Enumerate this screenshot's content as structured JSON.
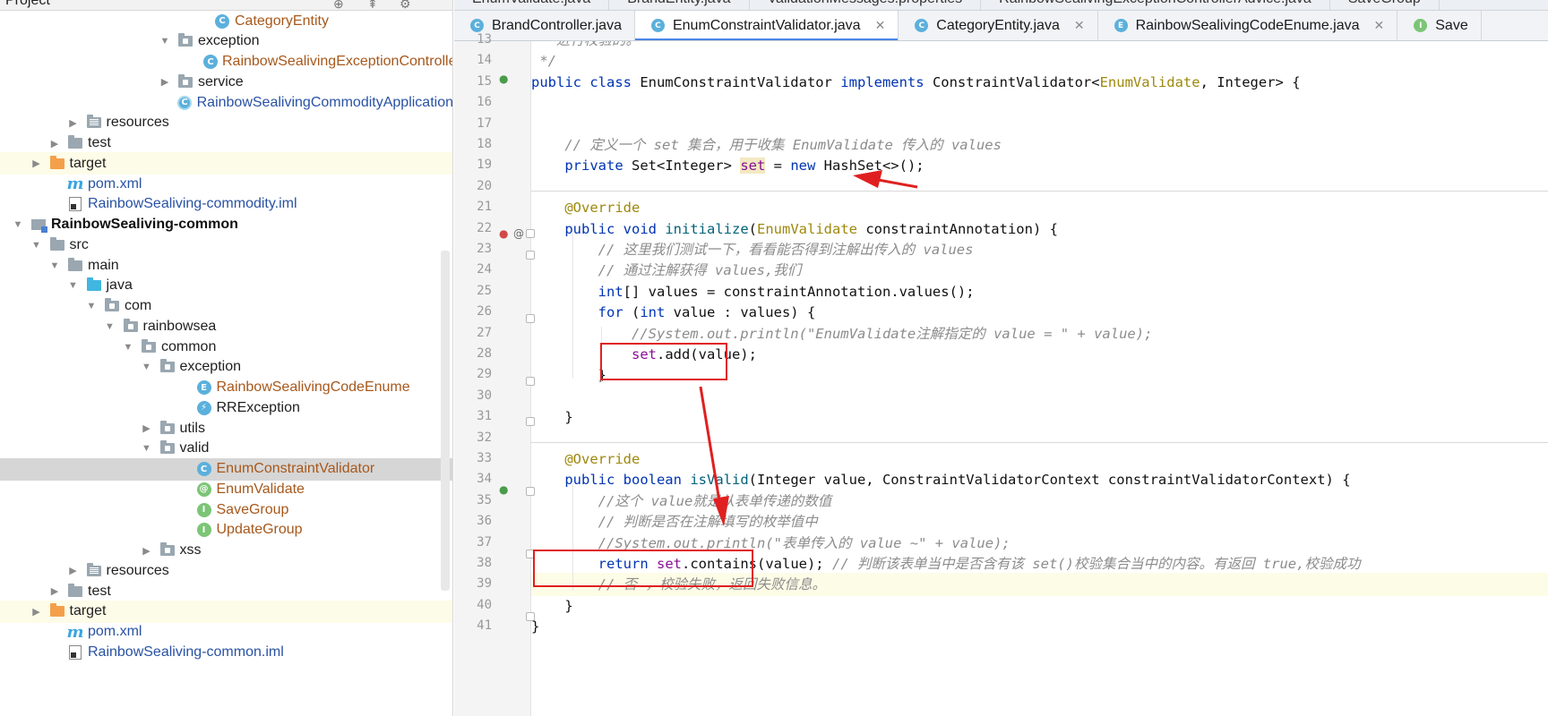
{
  "tree": {
    "header_title": "Project",
    "rows": [
      {
        "label": "CategoryEntity",
        "indent": 10,
        "kind": "class",
        "color": "brown"
      },
      {
        "label": "exception",
        "indent": 8,
        "kind": "pkg",
        "arrow": "down"
      },
      {
        "label": "RainbowSealivingExceptionControllerAdvice",
        "indent": 10,
        "kind": "class",
        "color": "brown"
      },
      {
        "label": "service",
        "indent": 8,
        "kind": "pkg",
        "arrow": "right"
      },
      {
        "label": "RainbowSealivingCommodityApplication",
        "indent": 8,
        "kind": "app",
        "color": "blue"
      },
      {
        "label": "resources",
        "indent": 3,
        "kind": "res",
        "arrow": "right"
      },
      {
        "label": "test",
        "indent": 2,
        "kind": "folder",
        "arrow": "right"
      },
      {
        "label": "target",
        "indent": 1,
        "kind": "orange",
        "arrow": "right",
        "target": true
      },
      {
        "label": "pom.xml",
        "indent": 2,
        "kind": "maven",
        "color": "blue"
      },
      {
        "label": "RainbowSealiving-commodity.iml",
        "indent": 2,
        "kind": "iml",
        "color": "blue"
      },
      {
        "label": "RainbowSealiving-common",
        "indent": 0,
        "kind": "module",
        "arrow": "down",
        "bold": true
      },
      {
        "label": "src",
        "indent": 1,
        "kind": "folder",
        "arrow": "down"
      },
      {
        "label": "main",
        "indent": 2,
        "kind": "folder",
        "arrow": "down"
      },
      {
        "label": "java",
        "indent": 3,
        "kind": "blue",
        "arrow": "down"
      },
      {
        "label": "com",
        "indent": 4,
        "kind": "pkg",
        "arrow": "down"
      },
      {
        "label": "rainbowsea",
        "indent": 5,
        "kind": "pkg",
        "arrow": "down"
      },
      {
        "label": "common",
        "indent": 6,
        "kind": "pkg",
        "arrow": "down"
      },
      {
        "label": "exception",
        "indent": 7,
        "kind": "pkg",
        "arrow": "down"
      },
      {
        "label": "RainbowSealivingCodeEnume",
        "indent": 9,
        "kind": "enum",
        "color": "brown"
      },
      {
        "label": "RRException",
        "indent": 9,
        "kind": "exc"
      },
      {
        "label": "utils",
        "indent": 7,
        "kind": "pkg",
        "arrow": "right"
      },
      {
        "label": "valid",
        "indent": 7,
        "kind": "pkg",
        "arrow": "down"
      },
      {
        "label": "EnumConstraintValidator",
        "indent": 9,
        "kind": "class",
        "color": "brown",
        "selected": true
      },
      {
        "label": "EnumValidate",
        "indent": 9,
        "kind": "anno",
        "color": "brown"
      },
      {
        "label": "SaveGroup",
        "indent": 9,
        "kind": "iface",
        "color": "brown"
      },
      {
        "label": "UpdateGroup",
        "indent": 9,
        "kind": "iface",
        "color": "brown"
      },
      {
        "label": "xss",
        "indent": 7,
        "kind": "pkg",
        "arrow": "right"
      },
      {
        "label": "resources",
        "indent": 3,
        "kind": "res",
        "arrow": "right"
      },
      {
        "label": "test",
        "indent": 2,
        "kind": "folder",
        "arrow": "right"
      },
      {
        "label": "target",
        "indent": 1,
        "kind": "orange",
        "arrow": "right",
        "target": true
      },
      {
        "label": "pom.xml",
        "indent": 2,
        "kind": "maven",
        "color": "blue"
      },
      {
        "label": "RainbowSealiving-common.iml",
        "indent": 2,
        "kind": "iml",
        "color": "blue"
      }
    ]
  },
  "tabs_top": [
    "EnumValidate.java",
    "BrandEntity.java",
    "ValidationMessages.properties",
    "RainbowSealivingExceptionControllerAdvice.java",
    "SaveGroup"
  ],
  "tabs": [
    {
      "label": "BrandController.java",
      "active": false,
      "close": false
    },
    {
      "label": "EnumConstraintValidator.java",
      "active": true,
      "close": true
    },
    {
      "label": "CategoryEntity.java",
      "active": false,
      "close": true
    },
    {
      "label": "RainbowSealivingCodeEnume.java",
      "active": false,
      "close": true,
      "kind": "enum"
    },
    {
      "label": "Save",
      "active": false,
      "close": false,
      "kind": "iface"
    }
  ],
  "lines": [
    {
      "n": "13",
      "html": "<span class=\"cm\"> * 进行校验的。</span>"
    },
    {
      "n": "14",
      "html": "<span class=\"cm\"> */</span>"
    },
    {
      "n": "15",
      "html": "<span class=\"kw\">public class</span> EnumConstraintValidator <span class=\"kw\">implements</span> ConstraintValidator&lt;<span class=\"an\">EnumValidate</span>, Integer&gt; {"
    },
    {
      "n": "16",
      "html": ""
    },
    {
      "n": "17",
      "html": ""
    },
    {
      "n": "18",
      "html": "    <span class=\"cm\">// 定义一个 set 集合，用于收集 EnumValidate 传入的 values</span>"
    },
    {
      "n": "19",
      "html": "    <span class=\"kw\">private</span> Set&lt;Integer&gt; <span class=\"fld hl\">set</span> = <span class=\"kw\">new</span> HashSet&lt;&gt;();"
    },
    {
      "n": "20",
      "html": ""
    },
    {
      "n": "21",
      "html": "    <span class=\"an\">@Override</span>"
    },
    {
      "n": "22",
      "html": "    <span class=\"kw\">public void</span> <span style=\"color:#00627a\">initialize</span>(<span class=\"an\">EnumValidate</span> constraintAnnotation) {"
    },
    {
      "n": "23",
      "html": "        <span class=\"cm\">// 这里我们测试一下，看看能否得到注解出传入的 values</span>"
    },
    {
      "n": "24",
      "html": "        <span class=\"cm\">// 通过注解获得 values,我们</span>"
    },
    {
      "n": "25",
      "html": "        <span class=\"kw\">int</span>[] values = constraintAnnotation.values();"
    },
    {
      "n": "26",
      "html": "        <span class=\"kw\">for</span> (<span class=\"kw\">int</span> value : values) {"
    },
    {
      "n": "27",
      "html": "            <span class=\"cm\">//System.out.println(\"EnumValidate注解指定的 value = \" + value);</span>"
    },
    {
      "n": "28",
      "html": "            <span class=\"fld\">set</span>.add(value);"
    },
    {
      "n": "29",
      "html": "        }"
    },
    {
      "n": "30",
      "html": ""
    },
    {
      "n": "31",
      "html": "    }"
    },
    {
      "n": "32",
      "html": ""
    },
    {
      "n": "33",
      "html": "    <span class=\"an\">@Override</span>"
    },
    {
      "n": "34",
      "html": "    <span class=\"kw\">public boolean</span> <span style=\"color:#00627a\">isValid</span>(Integer value, ConstraintValidatorContext constraintValidatorContext) {"
    },
    {
      "n": "35",
      "html": "        <span class=\"cm\">//这个 value就是从表单传递的数值</span>"
    },
    {
      "n": "36",
      "html": "        <span class=\"cm\">// 判断是否在注解填写的枚举值中</span>"
    },
    {
      "n": "37",
      "html": "        <span class=\"cm\">//System.out.println(\"表单传入的 value ~\" + value);</span>"
    },
    {
      "n": "38",
      "html": "        <span class=\"kw\">return</span> <span class=\"fld\">set</span>.contains(value); <span class=\"cm\">// 判断该表单当中是否含有该 set()校验集合当中的内容。有返回 true,校验成功</span>"
    },
    {
      "n": "39",
      "html": "        <span class=\"cm\">// 否 ，校验失败，返回失败信息。</span>"
    },
    {
      "n": "40",
      "html": "    }"
    },
    {
      "n": "41",
      "html": "}"
    }
  ],
  "colors": {
    "keyword": "#0033b3",
    "comment": "#8c8c8c",
    "annotation": "#9e880d",
    "field": "#871094",
    "annotation_markup": "#e02020"
  }
}
